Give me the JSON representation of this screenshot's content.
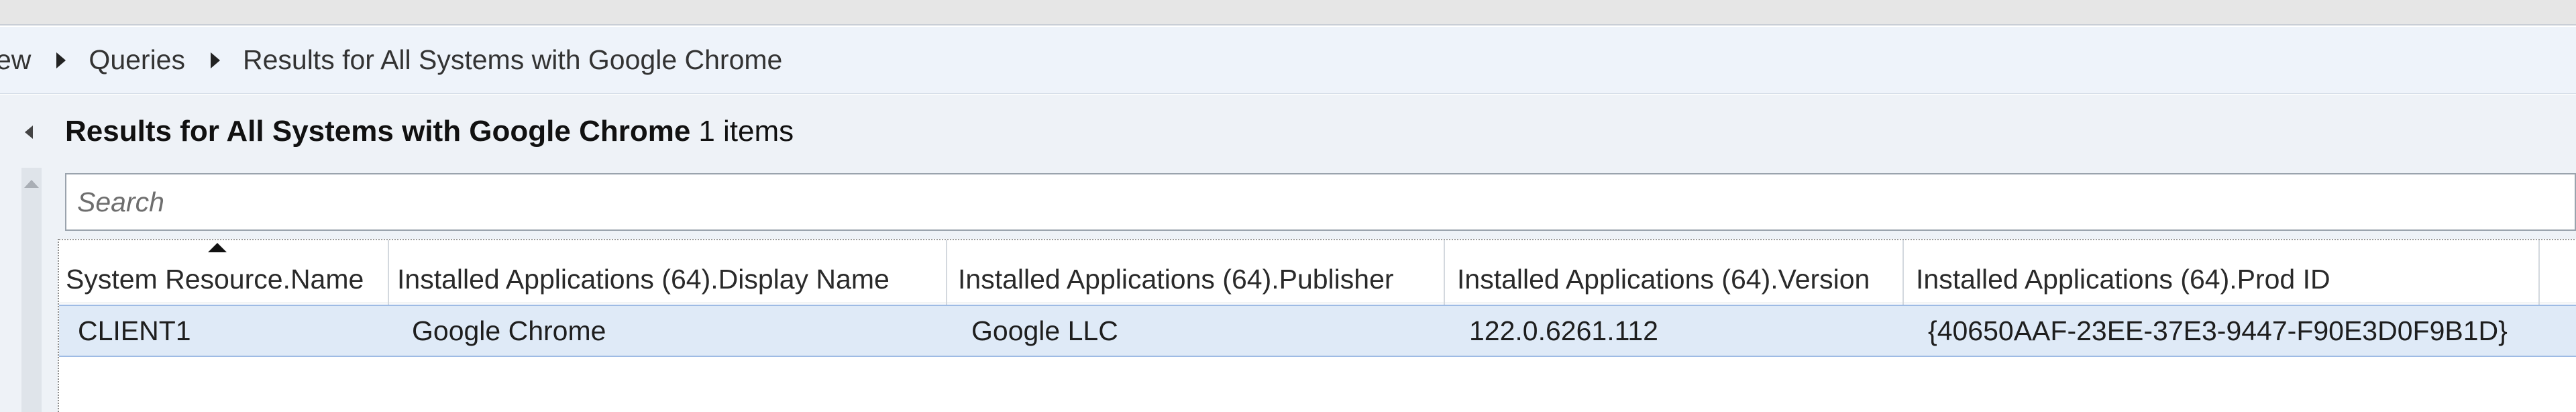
{
  "breadcrumb": {
    "items": [
      "ew",
      "Queries",
      "Results for All Systems with Google Chrome"
    ]
  },
  "results": {
    "title": "Results for All Systems with Google Chrome",
    "count": "1 items"
  },
  "search": {
    "placeholder": "Search"
  },
  "grid": {
    "columns": [
      "System Resource.Name",
      "Installed Applications (64).Display Name",
      "Installed Applications (64).Publisher",
      "Installed Applications (64).Version",
      "Installed Applications (64).Prod ID"
    ],
    "rows": [
      [
        "CLIENT1",
        "Google Chrome",
        "Google LLC",
        "122.0.6261.112",
        "{40650AAF-23EE-37E3-9447-F90E3D0F9B1D}"
      ]
    ],
    "sorted_column": "System Resource.Name",
    "sort_direction": "ascending"
  },
  "icons": {
    "collapse": "chevron-left-icon",
    "breadcrumb_separator": "caret-right-icon",
    "scroll_up": "scroll-up-arrow-icon"
  },
  "colors": {
    "selected_row": "#dfeaf7",
    "breadcrumb_bg": "#eef3fa"
  }
}
